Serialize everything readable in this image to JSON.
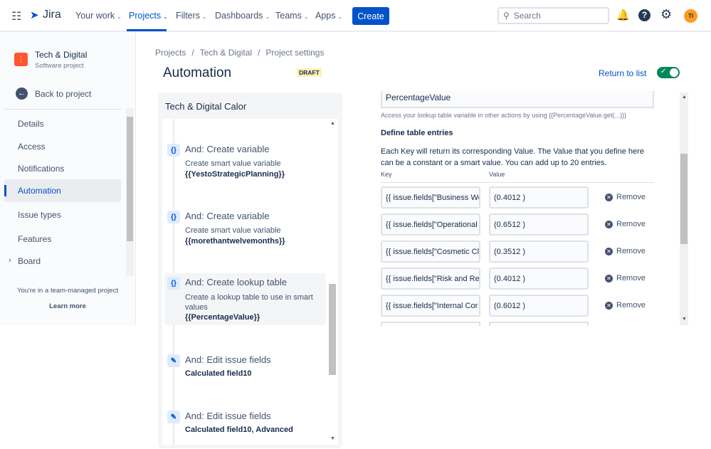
{
  "topbar": {
    "app": "Jira",
    "nav": [
      {
        "label": "Your work"
      },
      {
        "label": "Projects",
        "active": true
      },
      {
        "label": "Filters"
      },
      {
        "label": "Dashboards"
      },
      {
        "label": "Teams"
      },
      {
        "label": "Apps"
      }
    ],
    "create": "Create",
    "search_placeholder": "Search",
    "avatar": "TI",
    "avatar_color": "#ff991f",
    "accent": "#0052cc"
  },
  "sidebar": {
    "project_name": "Tech & Digital",
    "project_type": "Software project",
    "back": "Back to project",
    "items": [
      {
        "label": "Details"
      },
      {
        "label": "Access"
      },
      {
        "label": "Notifications"
      },
      {
        "label": "Automation",
        "active": true
      },
      {
        "label": "Issue types"
      },
      {
        "label": "Features"
      },
      {
        "label": "Board"
      }
    ],
    "footer": "You're in a team-managed project",
    "learn_more": "Learn more"
  },
  "breadcrumb": [
    "Projects",
    "Tech & Digital",
    "Project settings"
  ],
  "page": {
    "title": "Automation",
    "badge": "DRAFT",
    "return": "Return to list",
    "enabled": true
  },
  "rule": {
    "name": "Tech & Digital Calor",
    "steps": [
      {
        "icon": "braces-icon",
        "title": "And: Create variable",
        "desc": "Create smart value variable",
        "bold": "{{YestoStrategicPlanning}}"
      },
      {
        "icon": "braces-icon",
        "title": "And: Create variable",
        "desc": "Create smart value variable",
        "bold": "{{morethantwelvemonths}}"
      },
      {
        "icon": "braces-icon",
        "title": "And: Create lookup table",
        "desc": "Create a lookup table to use in smart values",
        "bold": "{{PercentageValue}}",
        "selected": true
      },
      {
        "icon": "pencil-icon",
        "title": "And: Edit issue fields",
        "desc": "",
        "bold": "Calculated field10"
      },
      {
        "icon": "pencil-icon",
        "title": "And: Edit issue fields",
        "desc": "",
        "bold": "Calculated field10",
        "bold2": "Advanced"
      }
    ]
  },
  "config": {
    "variable_name": "PercentageValue",
    "helper": "Access your lookup table variable in other actions by using {{PercentageValue.get(...)}}",
    "section_title": "Define table entries",
    "section_desc": "Each Key will return its corresponding Value. The Value that you define here can be a constant or a smart value. You can add up to 20 entries.",
    "key_header": "Key",
    "value_header": "Value",
    "remove": "Remove",
    "entries": [
      {
        "key": "{{ issue.fields[\"Business Wo",
        "value": "(0.4012 )"
      },
      {
        "key": "{{ issue.fields[\"Operational",
        "value": "(0.6512 )"
      },
      {
        "key": "{{ issue.fields[\"Cosmetic Cl",
        "value": "(0.3512 )"
      },
      {
        "key": "{{ issue.fields[\"Risk and Re",
        "value": "(0.4012 )"
      },
      {
        "key": "{{ issue.fields[\"Internal Cor",
        "value": "(0.6012 )"
      }
    ]
  }
}
